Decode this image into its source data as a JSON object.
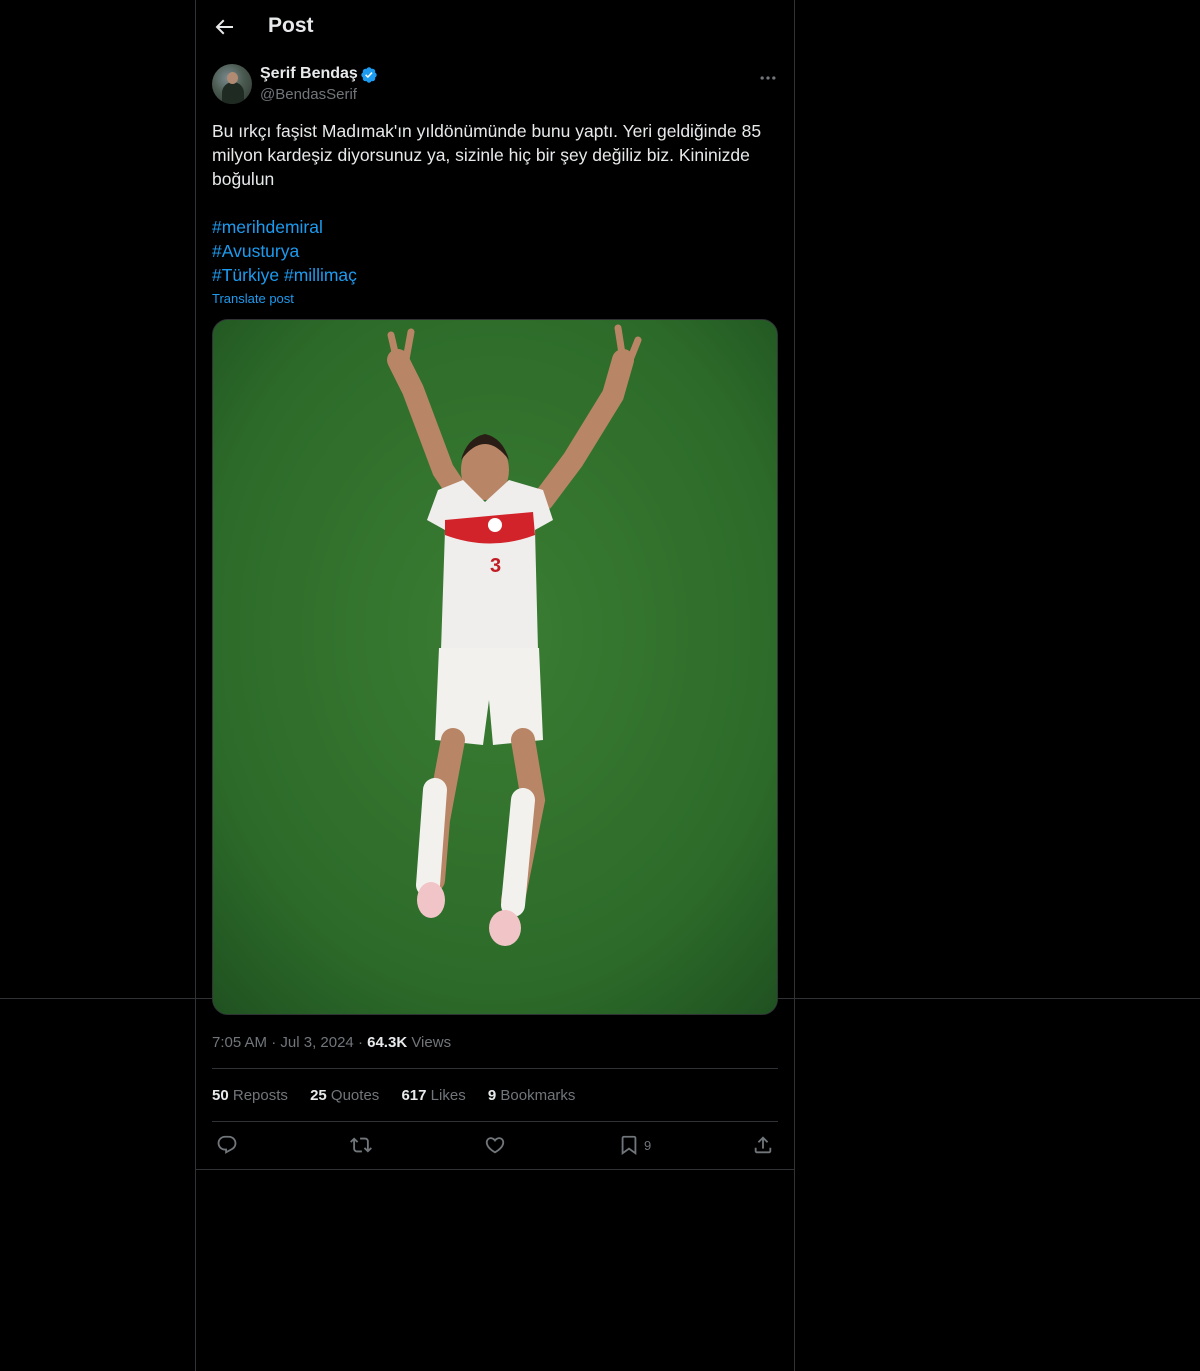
{
  "header": {
    "title": "Post"
  },
  "author": {
    "display_name": "Şerif Bendaş",
    "handle": "@BendasSerif"
  },
  "post": {
    "text": "Bu ırkçı faşist Madımak'ın yıldönümünde bunu yaptı. Yeri geldiğinde 85 milyon kardeşiz diyorsunuz ya, sizinle hiç bir şey değiliz biz. Kininizde boğulun",
    "hashtags": [
      "#merihdemiral",
      "#Avusturya",
      "#Türkiye",
      "#millimaç"
    ],
    "translate_label": "Translate post"
  },
  "meta": {
    "time": "7:05 AM",
    "date": "Jul 3, 2024",
    "views_count": "64.3K",
    "views_label": "Views"
  },
  "stats": {
    "reposts_count": "50",
    "reposts_label": "Reposts",
    "quotes_count": "25",
    "quotes_label": "Quotes",
    "likes_count": "617",
    "likes_label": "Likes",
    "bookmarks_count": "9",
    "bookmarks_label": "Bookmarks"
  },
  "actions": {
    "bookmark_count": "9"
  },
  "icons": [
    "back-arrow-icon",
    "verified-badge-icon",
    "more-options-icon",
    "reply-icon",
    "repost-icon",
    "like-icon",
    "bookmark-icon",
    "share-icon"
  ],
  "colors": {
    "background": "#000000",
    "text": "#e7e9ea",
    "secondary": "#71767b",
    "accent": "#1d9bf0",
    "border": "#2f3336"
  }
}
